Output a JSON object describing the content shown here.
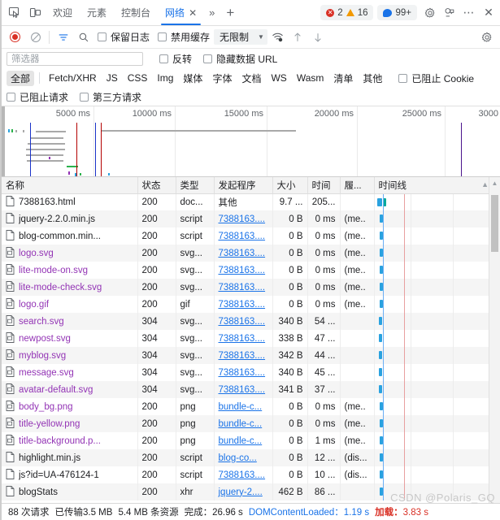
{
  "tabstrip": {
    "icons": [
      {
        "name": "inspect-element-icon"
      },
      {
        "name": "device-toolbar-icon"
      }
    ],
    "tabs": [
      {
        "label": "欢迎",
        "active": false
      },
      {
        "label": "元素",
        "active": false
      },
      {
        "label": "控制台",
        "active": false
      },
      {
        "label": "网络",
        "active": true,
        "closable": true
      }
    ],
    "more_tabs_label": "»",
    "add_tab_label": "+",
    "badges": {
      "errors": "2",
      "warnings": "16",
      "info": "99+"
    },
    "right_icons": [
      {
        "name": "settings-gear-icon"
      },
      {
        "name": "customize-devtools-icon"
      },
      {
        "name": "more-options-icon",
        "label": "⋯"
      },
      {
        "name": "close-devtools-icon",
        "label": "✕"
      }
    ]
  },
  "toolbar": {
    "record_label": "record-button",
    "clear_label": "clear-button",
    "filter_label": "filter-button",
    "search_label": "search-button",
    "preserve_log": "保留日志",
    "disable_cache": "禁用缓存",
    "throttle_value": "无限制",
    "throttle_arrow": "▼",
    "wifi_label": "network-conditions",
    "import_label": "import-har",
    "export_label": "export-har",
    "settings_label": "network-settings"
  },
  "filter": {
    "placeholder": "筛选器",
    "value": "",
    "invert": "反转",
    "hide_data_urls": "隐藏数据 URL",
    "types": [
      {
        "label": "全部",
        "selected": true
      },
      {
        "label": "Fetch/XHR",
        "selected": false
      },
      {
        "label": "JS",
        "selected": false
      },
      {
        "label": "CSS",
        "selected": false
      },
      {
        "label": "Img",
        "selected": false
      },
      {
        "label": "媒体",
        "selected": false
      },
      {
        "label": "字体",
        "selected": false
      },
      {
        "label": "文档",
        "selected": false
      },
      {
        "label": "WS",
        "selected": false
      },
      {
        "label": "Wasm",
        "selected": false
      },
      {
        "label": "清单",
        "selected": false
      },
      {
        "label": "其他",
        "selected": false
      }
    ],
    "blocked_cookies": "已阻止 Cookie",
    "blocked_requests": "已阻止请求",
    "third_party": "第三方请求"
  },
  "overview": {
    "ticks": [
      "5000 ms",
      "10000 ms",
      "15000 ms",
      "20000 ms",
      "25000 ms",
      "3000"
    ],
    "dcl_color": "#1a32c8",
    "load_color": "#b30000"
  },
  "table": {
    "columns": [
      {
        "key": "name",
        "label": "名称"
      },
      {
        "key": "status",
        "label": "状态"
      },
      {
        "key": "type",
        "label": "类型"
      },
      {
        "key": "initiator",
        "label": "发起程序"
      },
      {
        "key": "size",
        "label": "大小"
      },
      {
        "key": "time",
        "label": "时间"
      },
      {
        "key": "cascade",
        "label": "履..."
      },
      {
        "key": "waterfall",
        "label": "时间线"
      }
    ],
    "sort_indicator": "▲",
    "rows": [
      {
        "name": "7388163.html",
        "icon": "document-file-icon",
        "is_image": false,
        "status": "200",
        "type": "doc...",
        "initiator": "其他",
        "initiator_link": false,
        "size": "9.7 ...",
        "time": "205...",
        "cascade": ""
      },
      {
        "name": "jquery-2.2.0.min.js",
        "icon": "document-file-icon",
        "is_image": false,
        "status": "200",
        "type": "script",
        "initiator": "7388163....",
        "initiator_link": true,
        "size": "0 B",
        "time": "0 ms",
        "cascade": "(me.."
      },
      {
        "name": "blog-common.min...",
        "icon": "document-file-icon",
        "is_image": false,
        "status": "200",
        "type": "script",
        "initiator": "7388163....",
        "initiator_link": true,
        "size": "0 B",
        "time": "0 ms",
        "cascade": "(me.."
      },
      {
        "name": "logo.svg",
        "icon": "image-file-icon",
        "is_image": true,
        "status": "200",
        "type": "svg...",
        "initiator": "7388163....",
        "initiator_link": true,
        "size": "0 B",
        "time": "0 ms",
        "cascade": "(me.."
      },
      {
        "name": "lite-mode-on.svg",
        "icon": "image-file-icon",
        "is_image": true,
        "status": "200",
        "type": "svg...",
        "initiator": "7388163....",
        "initiator_link": true,
        "size": "0 B",
        "time": "0 ms",
        "cascade": "(me.."
      },
      {
        "name": "lite-mode-check.svg",
        "icon": "image-file-icon",
        "is_image": true,
        "status": "200",
        "type": "svg...",
        "initiator": "7388163....",
        "initiator_link": true,
        "size": "0 B",
        "time": "0 ms",
        "cascade": "(me.."
      },
      {
        "name": "logo.gif",
        "icon": "image-file-icon",
        "is_image": true,
        "status": "200",
        "type": "gif",
        "initiator": "7388163....",
        "initiator_link": true,
        "size": "0 B",
        "time": "0 ms",
        "cascade": "(me.."
      },
      {
        "name": "search.svg",
        "icon": "image-file-icon",
        "is_image": true,
        "status": "304",
        "type": "svg...",
        "initiator": "7388163....",
        "initiator_link": true,
        "size": "340 B",
        "time": "54 ...",
        "cascade": ""
      },
      {
        "name": "newpost.svg",
        "icon": "image-file-icon",
        "is_image": true,
        "status": "304",
        "type": "svg...",
        "initiator": "7388163....",
        "initiator_link": true,
        "size": "338 B",
        "time": "47 ...",
        "cascade": ""
      },
      {
        "name": "myblog.svg",
        "icon": "image-file-icon",
        "is_image": true,
        "status": "304",
        "type": "svg...",
        "initiator": "7388163....",
        "initiator_link": true,
        "size": "342 B",
        "time": "44 ...",
        "cascade": ""
      },
      {
        "name": "message.svg",
        "icon": "image-file-icon",
        "is_image": true,
        "status": "304",
        "type": "svg...",
        "initiator": "7388163....",
        "initiator_link": true,
        "size": "340 B",
        "time": "45 ...",
        "cascade": ""
      },
      {
        "name": "avatar-default.svg",
        "icon": "image-file-icon",
        "is_image": true,
        "status": "304",
        "type": "svg...",
        "initiator": "7388163....",
        "initiator_link": true,
        "size": "341 B",
        "time": "37 ...",
        "cascade": ""
      },
      {
        "name": "body_bg.png",
        "icon": "image-file-icon",
        "is_image": true,
        "status": "200",
        "type": "png",
        "initiator": "bundle-c...",
        "initiator_link": true,
        "size": "0 B",
        "time": "0 ms",
        "cascade": "(me.."
      },
      {
        "name": "title-yellow.png",
        "icon": "image-file-icon",
        "is_image": true,
        "status": "200",
        "type": "png",
        "initiator": "bundle-c...",
        "initiator_link": true,
        "size": "0 B",
        "time": "0 ms",
        "cascade": "(me.."
      },
      {
        "name": "title-background.p...",
        "icon": "image-file-icon",
        "is_image": true,
        "status": "200",
        "type": "png",
        "initiator": "bundle-c...",
        "initiator_link": true,
        "size": "0 B",
        "time": "1 ms",
        "cascade": "(me.."
      },
      {
        "name": "highlight.min.js",
        "icon": "document-file-icon",
        "is_image": false,
        "status": "200",
        "type": "script",
        "initiator": "blog-co...",
        "initiator_link": true,
        "size": "0 B",
        "time": "12 ...",
        "cascade": "(dis..."
      },
      {
        "name": "js?id=UA-476124-1",
        "icon": "document-file-icon",
        "is_image": false,
        "status": "200",
        "type": "script",
        "initiator": "7388163....",
        "initiator_link": true,
        "size": "0 B",
        "time": "10 ...",
        "cascade": "(dis..."
      },
      {
        "name": "blogStats",
        "icon": "document-file-icon",
        "is_image": false,
        "status": "200",
        "type": "xhr",
        "initiator": "jquery-2....",
        "initiator_link": true,
        "size": "462 B",
        "time": "86 ...",
        "cascade": ""
      }
    ]
  },
  "statusbar": {
    "requests": "88 次请求",
    "transferred": "已传输3.5 MB",
    "resources": "5.4 MB 条资源",
    "finish": "完成：26.96 s",
    "dcl": "DOMContentLoaded：1.19 s",
    "load_label": "加载：",
    "load_value": "3.83 s"
  },
  "watermark": "CSDN @Polaris_GQ"
}
